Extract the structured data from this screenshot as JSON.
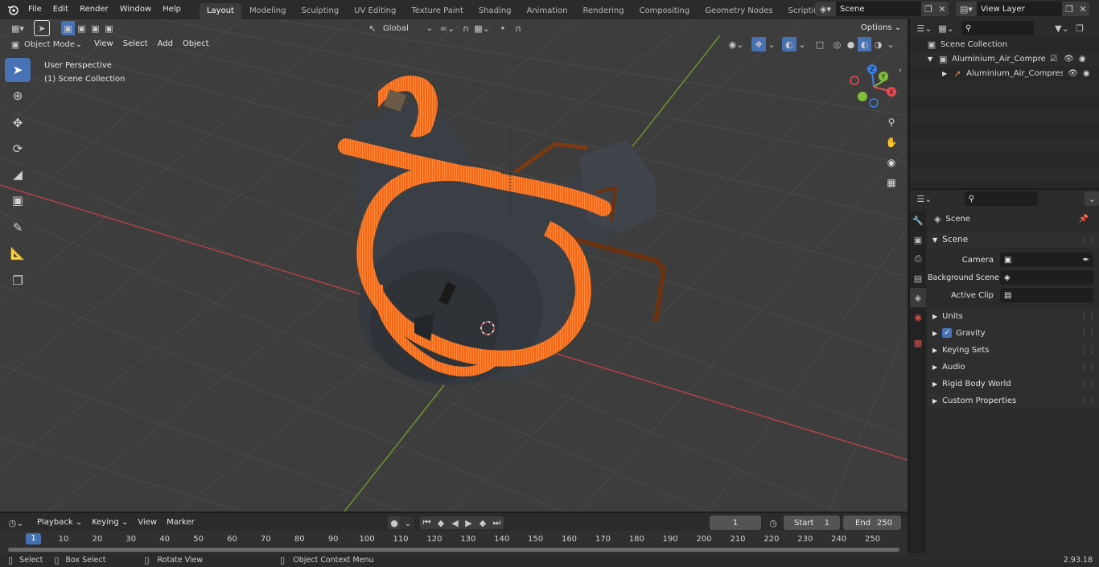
{
  "topbar": {
    "menus": [
      "File",
      "Edit",
      "Render",
      "Window",
      "Help"
    ],
    "workspaces": [
      "Layout",
      "Modeling",
      "Sculpting",
      "UV Editing",
      "Texture Paint",
      "Shading",
      "Animation",
      "Rendering",
      "Compositing",
      "Geometry Nodes",
      "Scripting"
    ],
    "active_workspace": "Layout",
    "scene_name": "Scene",
    "view_layer": "View Layer"
  },
  "viewport_header": {
    "mode": "Object Mode",
    "menus": [
      "View",
      "Select",
      "Add",
      "Object"
    ],
    "transform_orientation": "Global",
    "options_label": "Options"
  },
  "viewport": {
    "perspective_label": "User Perspective",
    "collection_label": "(1) Scene Collection",
    "gizmo_axes": [
      "X",
      "Y",
      "Z"
    ]
  },
  "outliner": {
    "search_placeholder": "",
    "root": "Scene Collection",
    "items": [
      {
        "label": "Aluminium_Air_Compressor_f"
      },
      {
        "label": "Aluminium_Air_Compres"
      }
    ]
  },
  "properties": {
    "context_title": "Scene",
    "section_scene": "Scene",
    "fields": [
      {
        "label": "Camera",
        "value": ""
      },
      {
        "label": "Background Scene",
        "value": ""
      },
      {
        "label": "Active Clip",
        "value": ""
      }
    ],
    "panels": [
      "Units",
      "Gravity",
      "Keying Sets",
      "Audio",
      "Rigid Body World",
      "Custom Properties"
    ],
    "gravity_checked": true
  },
  "timeline": {
    "menus": [
      "Playback",
      "Keying",
      "View",
      "Marker"
    ],
    "current_frame": "1",
    "start_label": "Start",
    "start_value": "1",
    "end_label": "End",
    "end_value": "250",
    "ticks": [
      "1",
      "10",
      "20",
      "30",
      "40",
      "50",
      "60",
      "70",
      "80",
      "90",
      "100",
      "110",
      "120",
      "130",
      "140",
      "150",
      "160",
      "170",
      "180",
      "190",
      "200",
      "210",
      "220",
      "230",
      "240",
      "250"
    ]
  },
  "statusbar": {
    "items": [
      "Select",
      "Box Select",
      "Rotate View",
      "Object Context Menu"
    ],
    "version": "2.93.18"
  },
  "colors": {
    "accent": "#4772b3",
    "x_axis": "#e84a4f",
    "y_axis": "#7fbf3a",
    "z_axis": "#3a7fe0",
    "hose": "#f06a1a"
  }
}
